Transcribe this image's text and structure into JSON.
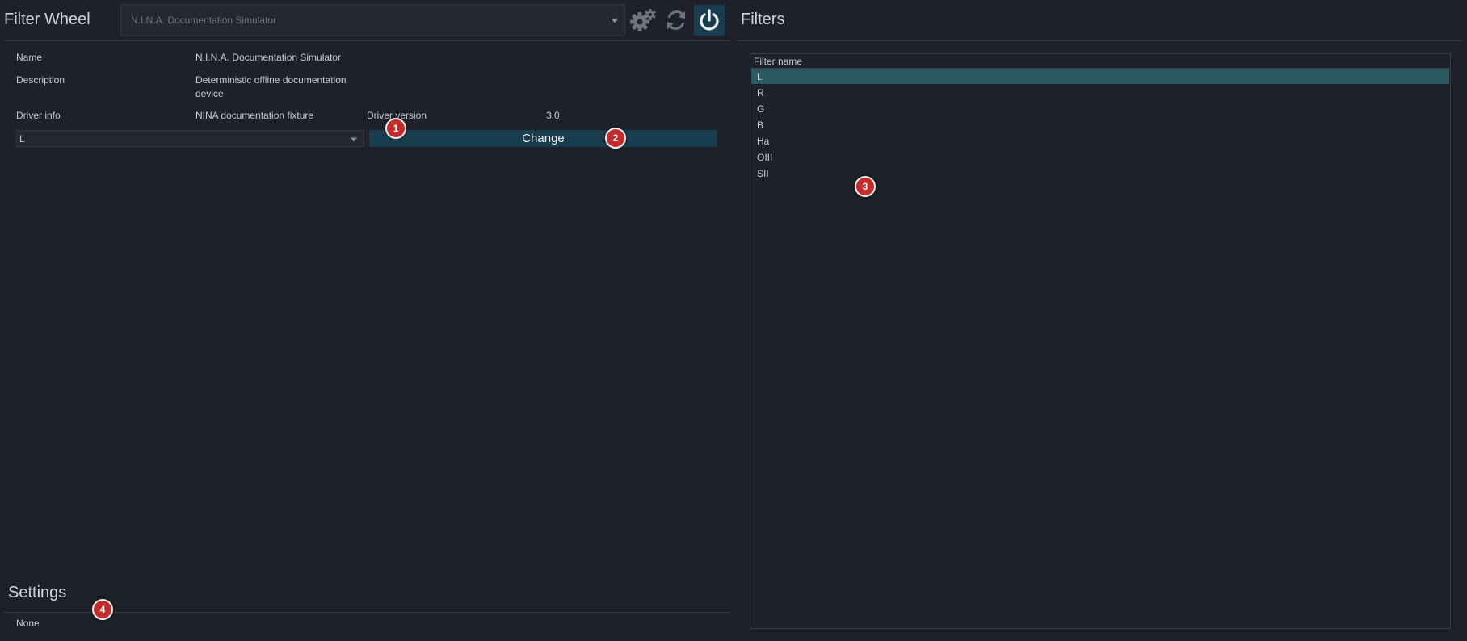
{
  "left_panel": {
    "title": "Filter Wheel",
    "device_select": {
      "value": "N.I.N.A. Documentation Simulator"
    },
    "info": {
      "name_label": "Name",
      "name_value": "N.I.N.A. Documentation Simulator",
      "description_label": "Description",
      "description_value_line1": "Deterministic offline documentation",
      "description_value_line2": "device",
      "driver_info_label": "Driver info",
      "driver_info_value": "NINA documentation fixture",
      "driver_version_label": "Driver version",
      "driver_version_value": "3.0"
    },
    "filter_select": {
      "value": "L"
    },
    "change_label": "Change"
  },
  "settings": {
    "title": "Settings",
    "value": "None"
  },
  "right_panel": {
    "title": "Filters",
    "column_header": "Filter name",
    "filters": [
      "L",
      "R",
      "G",
      "B",
      "Ha",
      "OIII",
      "SII"
    ],
    "selected_index": 0
  },
  "badges": [
    "1",
    "2",
    "3",
    "4"
  ],
  "icons": [
    "settings-gears-icon",
    "refresh-icon",
    "power-icon",
    "dropdown-arrow-icon"
  ],
  "colors": {
    "background": "#1f2129",
    "accent": "#173d4f",
    "selected_row": "#2d5a60",
    "badge": "#c42b2b"
  }
}
